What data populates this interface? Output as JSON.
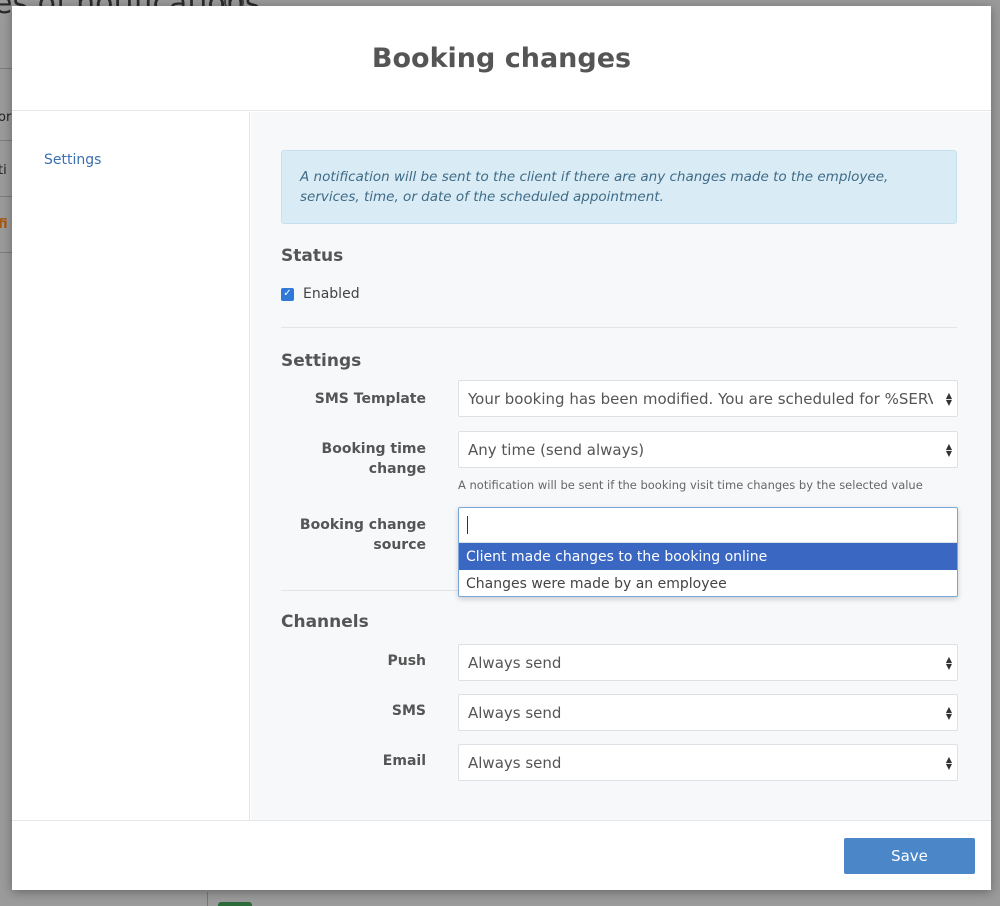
{
  "background": {
    "title_fragment": "es of notifications",
    "frag_1": "or",
    "frag_2": "ti",
    "frag_3": "fi"
  },
  "modal": {
    "title": "Booking changes"
  },
  "sidebar": {
    "items": [
      {
        "label": "Settings"
      }
    ]
  },
  "info": {
    "text": "A notification will be sent to the client if there are any changes made to the employee, services, time, or date of the scheduled appointment."
  },
  "status": {
    "heading": "Status",
    "enabled_label": "Enabled",
    "enabled": true
  },
  "settings": {
    "heading": "Settings",
    "sms_template": {
      "label": "SMS Template",
      "value": "Your booking has been modified. You are scheduled for %SERVICE_TITLE%"
    },
    "booking_time_change": {
      "label_line1": "Booking time",
      "label_line2": "change",
      "value": "Any time (send always)",
      "help": "A notification will be sent if the booking visit time changes by the selected value"
    },
    "booking_change_source": {
      "label_line1": "Booking change",
      "label_line2": "source",
      "input_value": "",
      "options": [
        {
          "label": "Client made changes to the booking online",
          "selected": true
        },
        {
          "label": "Changes were made by an employee",
          "selected": false
        }
      ]
    }
  },
  "channels": {
    "heading": "Channels",
    "push": {
      "label": "Push",
      "value": "Always send"
    },
    "sms": {
      "label": "SMS",
      "value": "Always send"
    },
    "email": {
      "label": "Email",
      "value": "Always send"
    }
  },
  "footer": {
    "save_label": "Save"
  },
  "colors": {
    "accent": "#3a67c2",
    "button": "#4a86c8",
    "link": "#3a6fb0",
    "alert_bg": "#d9ecf6"
  }
}
